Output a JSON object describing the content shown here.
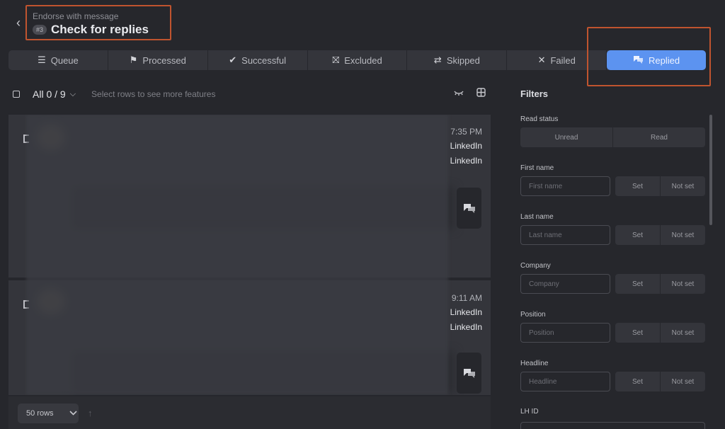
{
  "header": {
    "subtitle": "Endorse with message",
    "step_badge": "#3",
    "title": "Check for replies"
  },
  "tabs": [
    {
      "label": "Queue",
      "icon": "stack-icon",
      "glyph": "☰",
      "active": false
    },
    {
      "label": "Processed",
      "icon": "flag-icon",
      "glyph": "⚑",
      "active": false
    },
    {
      "label": "Successful",
      "icon": "check-icon",
      "glyph": "✔",
      "active": false
    },
    {
      "label": "Excluded",
      "icon": "excluded-icon",
      "glyph": "⛝",
      "active": false
    },
    {
      "label": "Skipped",
      "icon": "skip-icon",
      "glyph": "⇄",
      "active": false
    },
    {
      "label": "Failed",
      "icon": "x-icon",
      "glyph": "✕",
      "active": false
    },
    {
      "label": "Replied",
      "icon": "chat-icon",
      "glyph": "💬",
      "active": true
    }
  ],
  "toolbar": {
    "all_label": "All 0 / 9",
    "select_hint": "Select rows to see more features"
  },
  "rows": [
    {
      "time": "7:35 PM",
      "source1": "LinkedIn",
      "source2": "LinkedIn"
    },
    {
      "time": "9:11 AM",
      "source1": "LinkedIn",
      "source2": "LinkedIn"
    }
  ],
  "footer": {
    "rows_label": "50 rows"
  },
  "filters": {
    "title": "Filters",
    "read_status": {
      "label": "Read status",
      "options": [
        "Unread",
        "Read"
      ]
    },
    "fields": [
      {
        "label": "First name",
        "placeholder": "First name",
        "set": "Set",
        "not_set": "Not set"
      },
      {
        "label": "Last name",
        "placeholder": "Last name",
        "set": "Set",
        "not_set": "Not set"
      },
      {
        "label": "Company",
        "placeholder": "Company",
        "set": "Set",
        "not_set": "Not set"
      },
      {
        "label": "Position",
        "placeholder": "Position",
        "set": "Set",
        "not_set": "Not set"
      },
      {
        "label": "Headline",
        "placeholder": "Headline",
        "set": "Set",
        "not_set": "Not set"
      }
    ],
    "lh_id_label": "LH ID"
  },
  "colors": {
    "accent": "#5c93f0",
    "highlight": "#c0542f",
    "background": "#26272c"
  }
}
